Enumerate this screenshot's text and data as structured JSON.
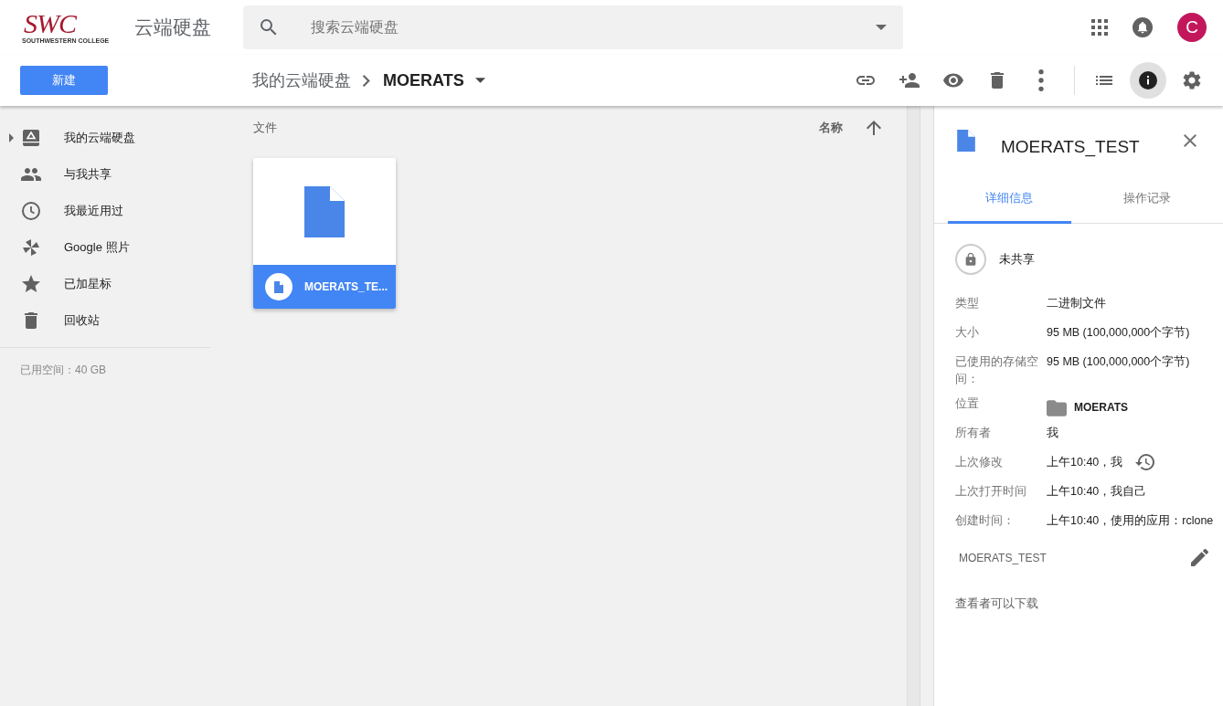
{
  "logo": {
    "mark": "SWC",
    "subtitle": "SOUTHWESTERN COLLEGE"
  },
  "app_title": "云端硬盘",
  "search": {
    "placeholder": "搜索云端硬盘"
  },
  "avatar": {
    "letter": "C"
  },
  "new_button": "新建",
  "breadcrumb": {
    "parent": "我的云端硬盘",
    "current": "MOERATS"
  },
  "toolbar": {
    "details_selected": true
  },
  "sidebar": {
    "items": [
      {
        "label": "我的云端硬盘",
        "selected": false
      },
      {
        "label": "与我共享",
        "selected": false
      },
      {
        "label": "我最近用过",
        "selected": false
      },
      {
        "label": "Google 照片",
        "selected": false
      },
      {
        "label": "已加星标",
        "selected": false
      },
      {
        "label": "回收站",
        "selected": false
      }
    ],
    "storage": "已用空间：40 GB"
  },
  "files": {
    "section_label": "文件",
    "sort_label": "名称",
    "items": [
      {
        "name": "MOERATS_TE...",
        "selected": true
      }
    ]
  },
  "details": {
    "title": "MOERATS_TEST",
    "tabs": [
      {
        "label": "详细信息",
        "selected": true
      },
      {
        "label": "操作记录",
        "selected": false
      }
    ],
    "sharing": "未共享",
    "rows": [
      {
        "kind": "text",
        "label": "类型",
        "value": "二进制文件"
      },
      {
        "kind": "text",
        "label": "大小",
        "value": "95 MB (100,000,000个字节)"
      },
      {
        "kind": "text",
        "label": "已使用的存储空间：",
        "value": "95 MB (100,000,000个字节)"
      },
      {
        "kind": "folder",
        "label": "位置",
        "value": "MOERATS"
      },
      {
        "kind": "text",
        "label": "所有者",
        "value": "我"
      },
      {
        "kind": "history",
        "label": "上次修改",
        "value": "上午10:40，我"
      },
      {
        "kind": "text",
        "label": "上次打开时间",
        "value": "上午10:40，我自己"
      },
      {
        "kind": "text",
        "label": "创建时间：",
        "value": "上午10:40，使用的应用：rclone"
      }
    ],
    "description": "MOERATS_TEST",
    "download_note": "查看者可以下载"
  }
}
